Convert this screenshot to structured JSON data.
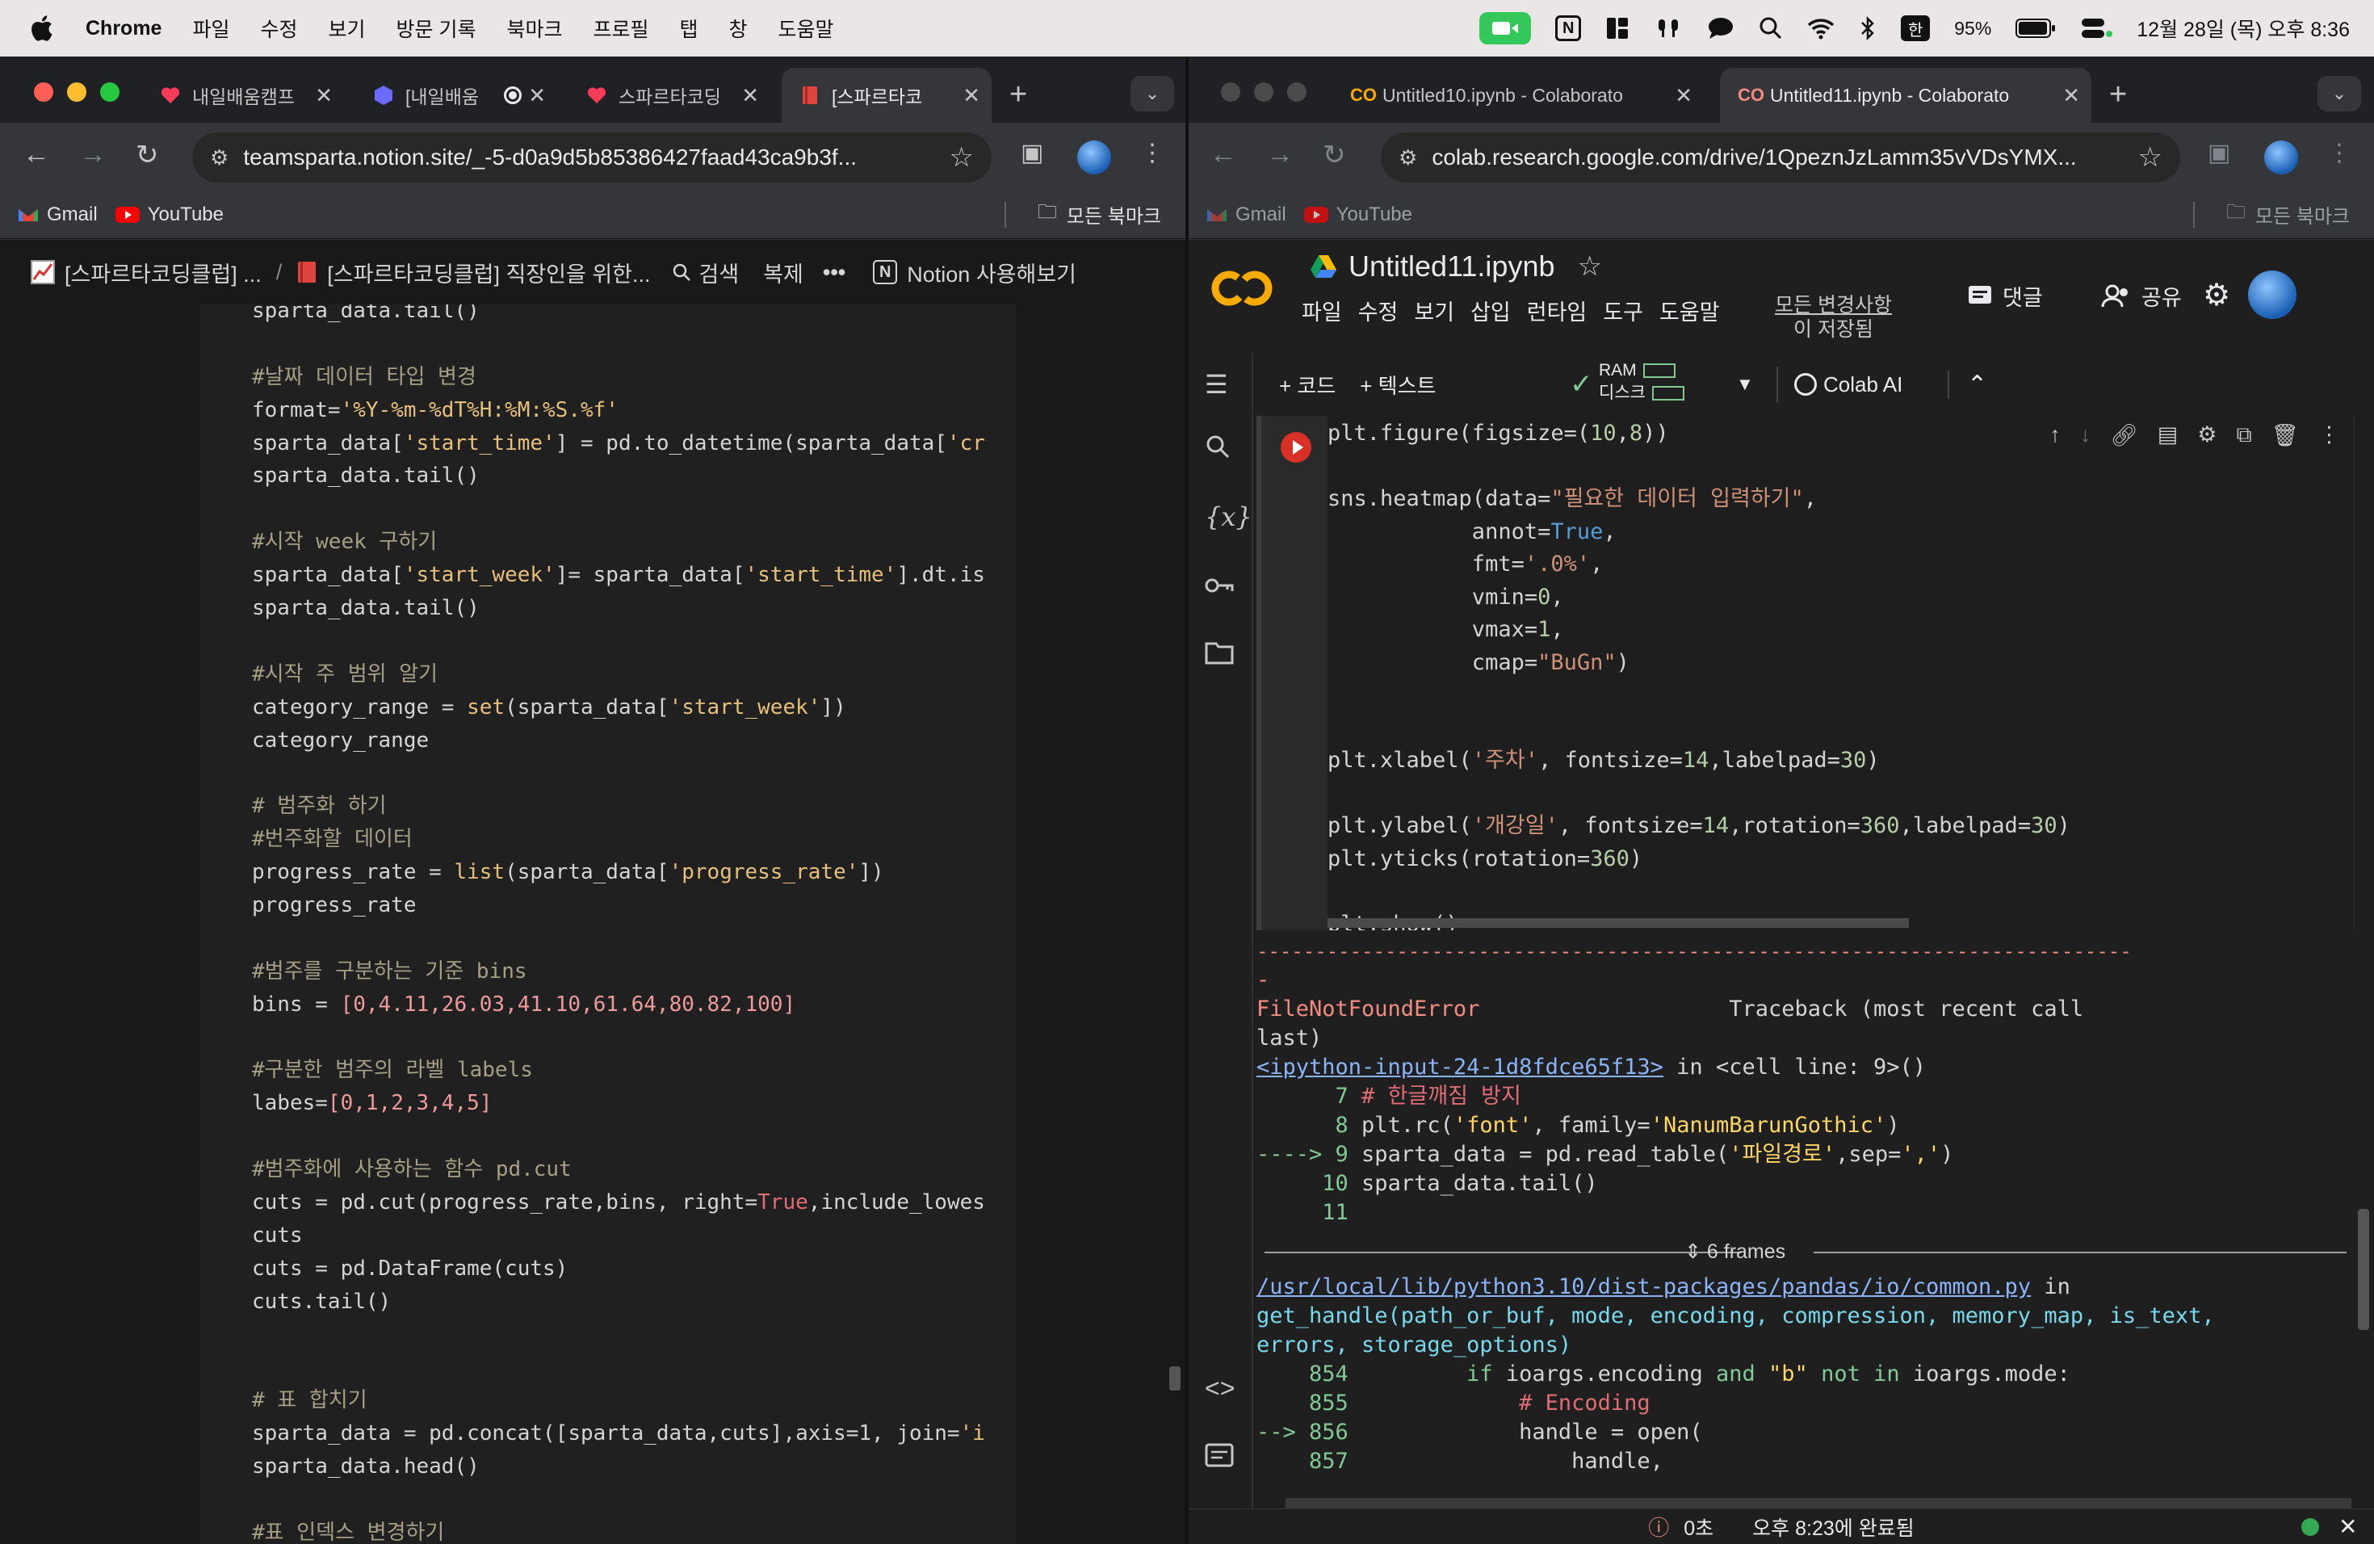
{
  "menubar": {
    "app": "Chrome",
    "items": [
      "파일",
      "수정",
      "보기",
      "방문 기록",
      "북마크",
      "프로필",
      "탭",
      "창",
      "도움말"
    ],
    "ime": "한",
    "battery": "95%",
    "datetime": "12월 28일 (목) 오후 8:36"
  },
  "left": {
    "tabs": [
      {
        "title": "내일배움캠프"
      },
      {
        "title": "[내일배움"
      },
      {
        "title": "스파르타코딩"
      },
      {
        "title": "[스파르타코"
      }
    ],
    "url": "teamsparta.notion.site/_-5-d0a9d5b85386427faad43ca9b3f...",
    "bookmarks": {
      "gmail": "Gmail",
      "youtube": "YouTube",
      "all": "모든 북마크"
    },
    "notion": {
      "crumb1": "[스파르타코딩클럽] ...",
      "sep": "/",
      "crumb2": "[스파르타코딩클럽] 직장인을 위한...",
      "search": "검색",
      "duplicate": "복제",
      "more": "•••",
      "try": "Notion 사용해보기"
    },
    "code_lines": [
      "sparta_data.tail()",
      "",
      "#날짜 데이터 타입 변경",
      "format='%Y-%m-%dT%H:%M:%S.%f'",
      "sparta_data['start_time'] = pd.to_datetime(sparta_data['cr",
      "sparta_data.tail()",
      "",
      "#시작 week 구하기",
      "sparta_data['start_week']= sparta_data['start_time'].dt.is",
      "sparta_data.tail()",
      "",
      "#시작 주 범위 알기",
      "category_range = set(sparta_data['start_week'])",
      "category_range",
      "",
      "# 범주화 하기",
      "#번주화할 데이터",
      "progress_rate = list(sparta_data['progress_rate'])",
      "progress_rate",
      "",
      "#범주를 구분하는 기준 bins",
      "bins = [0,4.11,26.03,41.10,61.64,80.82,100]",
      "",
      "#구분한 범주의 라벨 labels",
      "labes=[0,1,2,3,4,5]",
      "",
      "#범주화에 사용하는 함수 pd.cut",
      "cuts = pd.cut(progress_rate,bins, right=True,include_lowes",
      "cuts",
      "cuts = pd.DataFrame(cuts)",
      "cuts.tail()",
      "",
      "",
      "# 표 합치기",
      "sparta_data = pd.concat([sparta_data,cuts],axis=1, join='i",
      "sparta_data.head()",
      "",
      "#표 인덱스 변경하기"
    ]
  },
  "right": {
    "tabs": [
      {
        "title": "Untitled10.ipynb - Colaborato"
      },
      {
        "title": "Untitled11.ipynb - Colaborato"
      }
    ],
    "url": "colab.research.google.com/drive/1QpeznJzLamm35vVDsYMX...",
    "bookmarks": {
      "gmail": "Gmail",
      "youtube": "YouTube",
      "all": "모든 북마크"
    },
    "colab": {
      "title": "Untitled11.ipynb",
      "menu": [
        "파일",
        "수정",
        "보기",
        "삽입",
        "런타임",
        "도구",
        "도움말"
      ],
      "saved1": "모든 변경사항",
      "saved2": "이 저장됨",
      "comment": "댓글",
      "share": "공유",
      "add_code": "+ 코드",
      "add_text": "+ 텍스트",
      "ram": "RAM",
      "disk": "디스크",
      "ai": "Colab AI",
      "cell_lines": [
        "plt.figure(figsize=(10,8))",
        "",
        "sns.heatmap(data=\"필요한 데이터 입력하기\",",
        "           annot=True,",
        "           fmt='.0%',",
        "           vmin=0,",
        "           vmax=1,",
        "           cmap=\"BuGn\")",
        "",
        "",
        "plt.xlabel('주차', fontsize=14,labelpad=30)",
        "",
        "plt.ylabel('개강일', fontsize=14,rotation=360,labelpad=30)",
        "plt.yticks(rotation=360)",
        "",
        "plt.show()"
      ],
      "out": {
        "dashes": "---------------------------------------------------------------------------",
        "dash2": "-",
        "err": "FileNotFoundError",
        "tb": "Traceback (most recent call",
        "last": "last)",
        "link1": "<ipython-input-24-1d8fdce65f13>",
        "incell": " in <cell line: 9>()",
        "l7": "      7 # 한글깨짐 방지",
        "l8": "      8 plt.rc('font', family='NanumBarunGothic')",
        "l9": "----> 9 sparta_data = pd.read_table('파일경로',sep=',')",
        "l10": "     10 sparta_data.tail()",
        "l11": "     11",
        "frames": "6 frames",
        "link2": "/usr/local/lib/python3.10/dist-packages/pandas/io/common.py",
        "in": " in",
        "gh1": "get_handle(path_or_buf, mode, encoding, compression, memory_map, is_text,",
        "gh2": "errors, storage_options)",
        "l854": "    854         if ioargs.encoding and \"b\" not in ioargs.mode:",
        "l855": "    855             # Encoding",
        "l856": "--> 856             handle = open(",
        "l857": "    857                 handle,"
      },
      "status_time": "0초",
      "status_done": "오후 8:23에 완료됨"
    }
  }
}
